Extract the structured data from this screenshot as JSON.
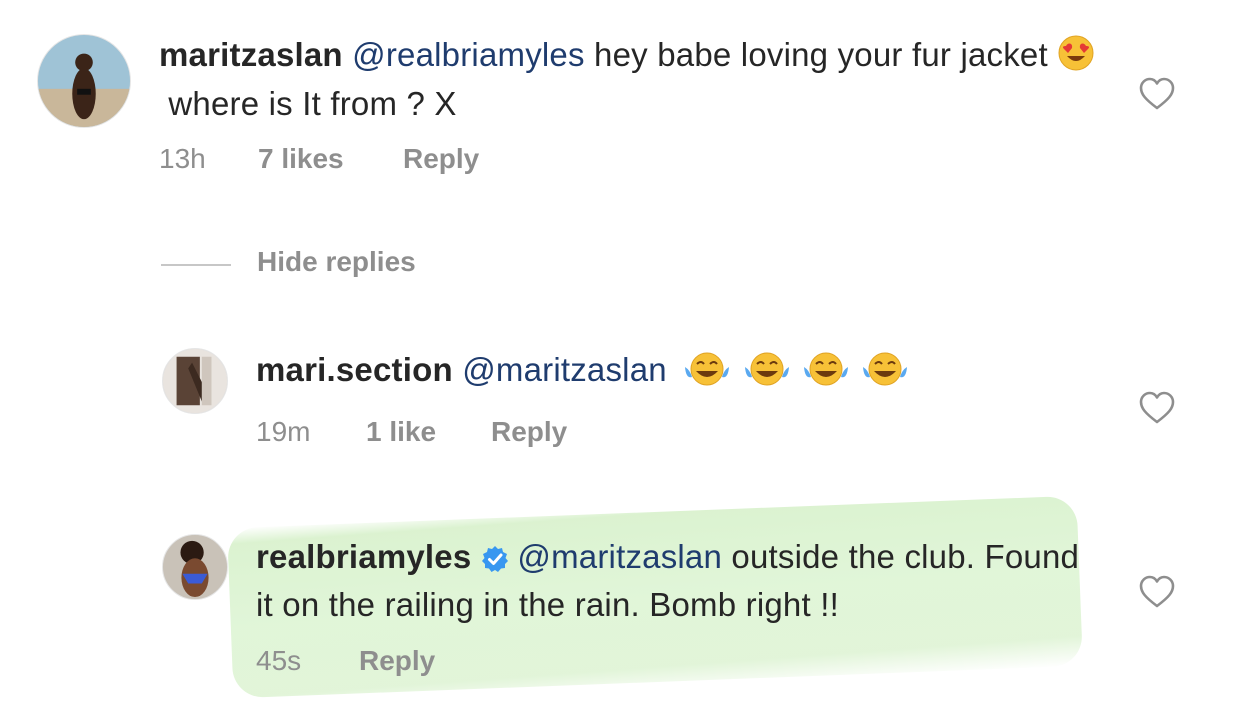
{
  "comments": [
    {
      "username": "maritzaslan",
      "mention": "@realbriamyles",
      "text_before_emoji": " hey babe loving your fur jacket ",
      "emoji": "smiling-face-with-heart-eyes",
      "text_after_emoji": "where is It from ? X",
      "time": "13h",
      "likes": "7 likes",
      "reply_label": "Reply"
    }
  ],
  "hide_replies_label": "Hide replies",
  "replies": [
    {
      "username": "mari.section",
      "mention": "@maritzaslan",
      "emoji": "face-with-tears-of-joy",
      "emoji_count": 4,
      "time": "19m",
      "likes": "1 like",
      "reply_label": "Reply"
    },
    {
      "username": "realbriamyles",
      "verified": true,
      "mention": "@maritzaslan",
      "text": " outside the club. Found it on the railing in the rain. Bomb right !!",
      "time": "45s",
      "reply_label": "Reply"
    }
  ],
  "colors": {
    "text": "#262626",
    "mention": "#1f3c6e",
    "meta": "#8e8e8e",
    "verified": "#3897f0",
    "highlight": "#bee8aa"
  }
}
